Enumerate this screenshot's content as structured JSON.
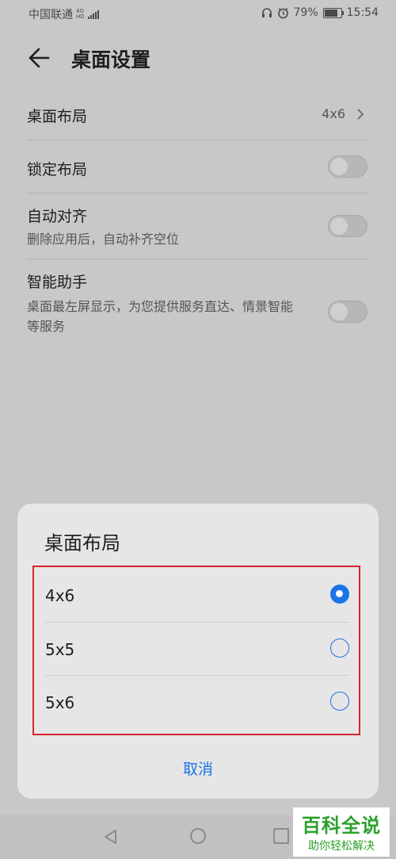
{
  "status_bar": {
    "carrier": "中国联通",
    "network_top": "4G",
    "network_bottom": "HD",
    "battery": "79%",
    "time": "15:54"
  },
  "header": {
    "title": "桌面设置"
  },
  "settings": {
    "layout": {
      "label": "桌面布局",
      "value": "4x6"
    },
    "lock_layout": {
      "label": "锁定布局",
      "enabled": false
    },
    "auto_align": {
      "label": "自动对齐",
      "desc": "删除应用后，自动补齐空位",
      "enabled": false
    },
    "smart_assistant": {
      "label": "智能助手",
      "desc": "桌面最左屏显示，为您提供服务直达、情景智能等服务",
      "enabled": false
    }
  },
  "dialog": {
    "title": "桌面布局",
    "options": [
      {
        "label": "4x6",
        "selected": true
      },
      {
        "label": "5x5",
        "selected": false
      },
      {
        "label": "5x6",
        "selected": false
      }
    ],
    "cancel_label": "取消"
  },
  "watermark": {
    "title": "百科全说",
    "subtitle": "助你轻松解决"
  },
  "colors": {
    "accent": "#1a73e8",
    "highlight_border": "#d6262c",
    "watermark_green": "#2ba12a"
  }
}
